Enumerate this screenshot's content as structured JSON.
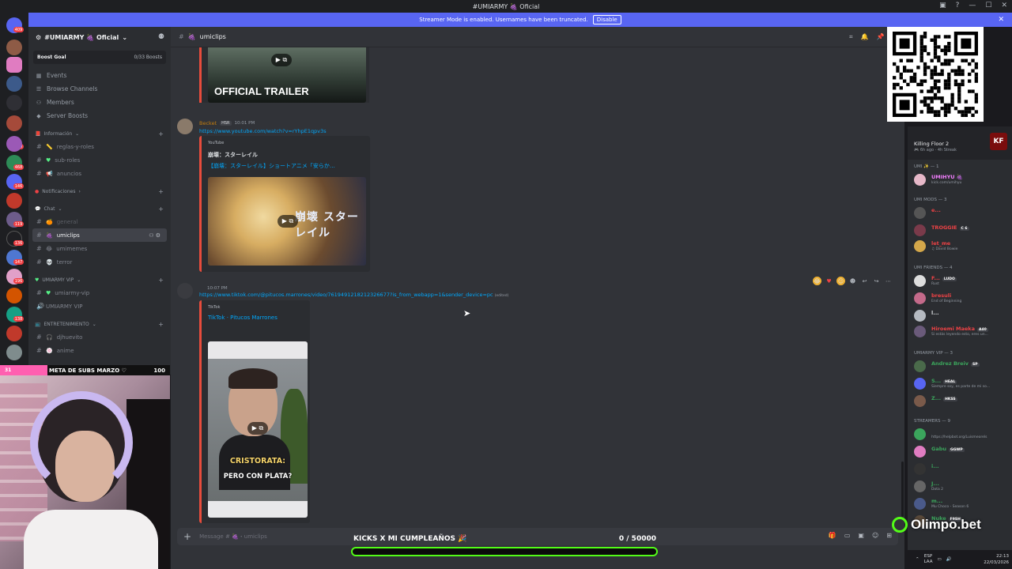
{
  "window": {
    "title": "#UMIARMY 🍇 Oficial"
  },
  "banner": {
    "text": "Streamer Mode is enabled. Usernames have been truncated.",
    "disable_label": "Disable"
  },
  "server_rail": {
    "badges": [
      "409",
      "149",
      "468",
      "146",
      "119",
      "136",
      "147",
      "196",
      "138"
    ]
  },
  "guild": {
    "name": "#UMIARMY 🍇 Oficial",
    "boost_goal": "Boost Goal",
    "boost_count": "0/33 Boosts",
    "nav": [
      {
        "icon": "events-icon",
        "label": "Events"
      },
      {
        "icon": "browse-icon",
        "label": "Browse Channels"
      },
      {
        "icon": "members-icon",
        "label": "Members"
      },
      {
        "icon": "boost-icon",
        "label": "Server Boosts"
      }
    ],
    "categories": {
      "informacion": "Información",
      "notificaciones": "Notificaciones",
      "chat": "Chat",
      "vip": "UMIARMY VIP",
      "entretenimiento": "ENTRETENIMIENTO"
    },
    "channels": {
      "reglas": "reglas-y-roles",
      "subroles": "sub-roles",
      "anuncios": "anuncios",
      "general": "general",
      "umiclips": "umiclips",
      "umimemes": "umimemes",
      "terror": "terror",
      "umiarmy_vip": "umiarmy-vip",
      "umiarmy_vip_voice": "UMIARMY VIP",
      "djhuevito": "djhuevito",
      "anime": "anime"
    }
  },
  "overlay": {
    "meta_label": "META DE SUBS MARZO ♡",
    "meta_current": "31",
    "meta_target": "100",
    "kicks_title": "KICKS X MI CUMPLEAÑOS 🎉",
    "kicks_count": "0",
    "kicks_target": "/ 50000",
    "kicks_progress": 0,
    "sponsor": "Olimpo.bet"
  },
  "channel": {
    "name": "umiclips",
    "composer_placeholder": "Message # 🍇・umiclips"
  },
  "messages": {
    "trailer_text": "OFFICIAL TRAILER",
    "msg1": {
      "author": "Becket",
      "tag": "HSR",
      "time": "10:01 PM",
      "link": "https://www.youtube.com/watch?v=rYhpE1qpv3s",
      "provider": "YouTube",
      "embed_title": "崩壊：スターレイル",
      "embed_link": "【崩壊：スターレイル】ショートアニメ「安らか…",
      "thumb_logo": "崩壊 スターレイル"
    },
    "msg2": {
      "time": "10:07 PM",
      "link": "https://www.tiktok.com/@pitucos.marrones/video/7619491218212326677?is_from_webapp=1&sender_device=pc",
      "edited": "(edited)",
      "provider": "TikTok",
      "embed_link": "TikTok · Pitucos Marrones",
      "caption1": "CRISTORATA:",
      "caption2": "PERO CON PLATA?"
    }
  },
  "members": {
    "activity_title": "Killing Floor 2",
    "activity_sub": "🎮 6h ago · 4h Streak",
    "activity_icon": "KF",
    "groups": {
      "umi": "UMI ✨ — 1",
      "umimods": "UMI MODS — 3",
      "friends": "UMI FRIENDS — 4",
      "vip": "UMIARMY VIP — 3",
      "streamers": "STREAMERS — 9"
    },
    "list": [
      {
        "name": "UMIHYU 🍇",
        "status": "kick.com/umihyu",
        "color": "#f47fff"
      },
      {
        "name": "e...",
        "status": "",
        "color": "#ed4245"
      },
      {
        "name": "TROGGIE",
        "tag": "C 6",
        "status": "",
        "color": "#ed4245"
      },
      {
        "name": "let_me",
        "status": "♫ David Bowie",
        "color": "#ed4245"
      },
      {
        "name": "F...",
        "tag": "LUDO",
        "status": "Rust",
        "color": "#ed4245"
      },
      {
        "name": "bresuli",
        "status": "End of Beginning",
        "color": "#ed4245"
      },
      {
        "name": "l...",
        "status": "",
        "color": "#dbdee1"
      },
      {
        "name": "Hiroemi Maeka",
        "tag": "A40",
        "status": "Si estás leyendo esto, eres un...",
        "color": "#ed4245"
      },
      {
        "name": "Andrez Breiv",
        "tag": "SP",
        "status": "",
        "color": "#3ba55c"
      },
      {
        "name": "S...",
        "tag": "HEAL",
        "status": "Siempre soy, es parte de mi so...",
        "color": "#3ba55c"
      },
      {
        "name": "Z...",
        "tag": "HKSS",
        "status": "",
        "color": "#3ba55c"
      },
      {
        "name": "ㅤ",
        "status": "https://helpbot.org/Luismeorels",
        "color": "#3ba55c"
      },
      {
        "name": "Gabu",
        "tag": "GGWP",
        "status": "",
        "color": "#3ba55c"
      },
      {
        "name": "i...",
        "status": "",
        "color": "#3ba55c"
      },
      {
        "name": "J...",
        "status": "Dota 2",
        "color": "#3ba55c"
      },
      {
        "name": "m...",
        "status": "Mu Choco - Season 6",
        "color": "#3ba55c"
      },
      {
        "name": "Nuke",
        "tag": "F9SH",
        "status": "",
        "color": "#3ba55c"
      }
    ]
  },
  "taskbar": {
    "lang": "ESP",
    "region": "LAA",
    "time": "22:13",
    "date": "22/03/2026"
  }
}
